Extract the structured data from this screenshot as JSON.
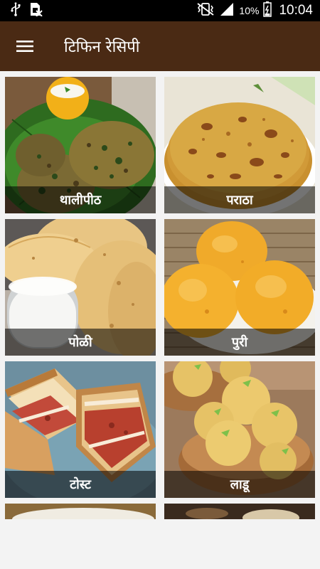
{
  "status_bar": {
    "battery_percent": "10%",
    "time": "10:04",
    "icons": [
      "usb-icon",
      "sim-card-icon",
      "vibrate-icon",
      "signal-icon",
      "battery-icon"
    ]
  },
  "app_bar": {
    "title": "टिफिन रेसिपी",
    "background_color": "#4a2a14",
    "menu_icon": "hamburger-menu-icon"
  },
  "recipes": [
    {
      "label": "थालीपीठ"
    },
    {
      "label": "पराठा"
    },
    {
      "label": "पोळी"
    },
    {
      "label": "पुरी"
    },
    {
      "label": "टोस्ट"
    },
    {
      "label": "लाडू"
    }
  ]
}
